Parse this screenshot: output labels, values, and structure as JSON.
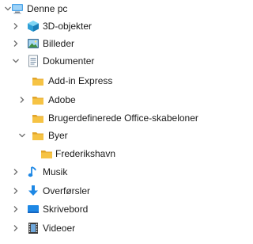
{
  "tree": {
    "this_pc": {
      "label": "Denne pc",
      "icon": "computer-icon"
    },
    "objects3d": {
      "label": "3D-objekter",
      "icon": "3d-cube-icon"
    },
    "pictures": {
      "label": "Billeder",
      "icon": "pictures-folder-icon"
    },
    "documents": {
      "label": "Dokumenter",
      "icon": "documents-folder-icon",
      "children": {
        "addin_express": {
          "label": "Add-in Express",
          "icon": "folder-icon"
        },
        "adobe": {
          "label": "Adobe",
          "icon": "folder-icon"
        },
        "custom_templates": {
          "label": "Brugerdefinerede Office-skabeloner",
          "icon": "folder-icon"
        },
        "cities": {
          "label": "Byer",
          "icon": "folder-icon",
          "children": {
            "frederikshavn": {
              "label": "Frederikshavn",
              "icon": "folder-icon"
            }
          }
        }
      }
    },
    "music": {
      "label": "Musik",
      "icon": "music-note-icon"
    },
    "downloads": {
      "label": "Overførsler",
      "icon": "download-arrow-icon"
    },
    "desktop": {
      "label": "Skrivebord",
      "icon": "desktop-icon"
    },
    "videos": {
      "label": "Videoer",
      "icon": "video-filmstrip-icon"
    }
  },
  "colors": {
    "chevron": "#6b6b6b",
    "folder": "#f6c344",
    "folder_dark": "#e2a52a",
    "accent_blue": "#1e88e5",
    "text": "#1a1a1a"
  }
}
